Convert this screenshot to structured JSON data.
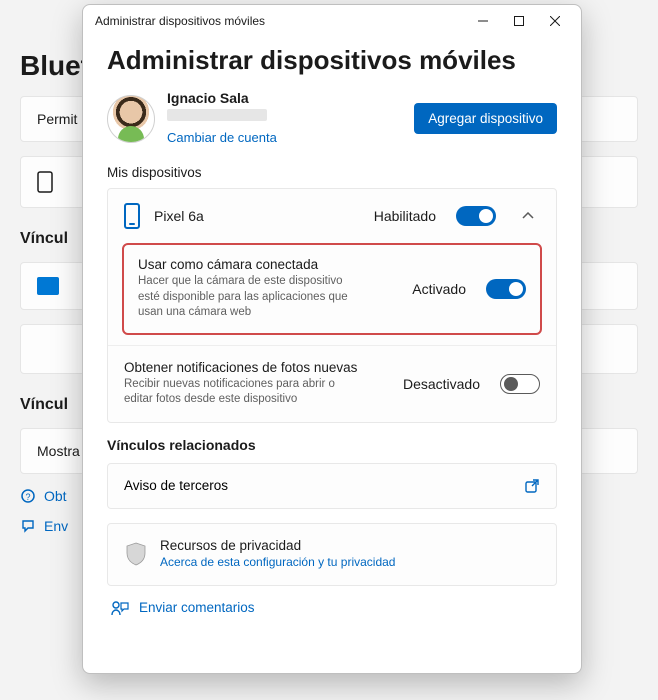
{
  "background": {
    "title_fragment": "Bluet",
    "card1": "Permit",
    "card2": "",
    "card3": "Víncul",
    "card4": "",
    "card5": "Víncul",
    "card6": "Mostra",
    "link1": "Obt",
    "link2": "Env"
  },
  "window": {
    "titlebar": "Administrar dispositivos móviles",
    "page_title": "Administrar dispositivos móviles",
    "account": {
      "name": "Ignacio Sala",
      "switch_link": "Cambiar de cuenta"
    },
    "add_button": "Agregar dispositivo",
    "my_devices_label": "Mis dispositivos",
    "device": {
      "name": "Pixel 6a",
      "status": "Habilitado"
    },
    "camera_option": {
      "title": "Usar como cámara conectada",
      "desc": "Hacer que la cámara de este dispositivo esté disponible para las aplicaciones que usan una cámara web",
      "status": "Activado"
    },
    "photos_option": {
      "title": "Obtener notificaciones de fotos nuevas",
      "desc": "Recibir nuevas notificaciones para abrir o editar fotos desde este dispositivo",
      "status": "Desactivado"
    },
    "related_links_label": "Vínculos relacionados",
    "third_party": "Aviso de terceros",
    "privacy": {
      "title": "Recursos de privacidad",
      "link": "Acerca de esta configuración y tu privacidad"
    },
    "feedback": "Enviar comentarios"
  }
}
